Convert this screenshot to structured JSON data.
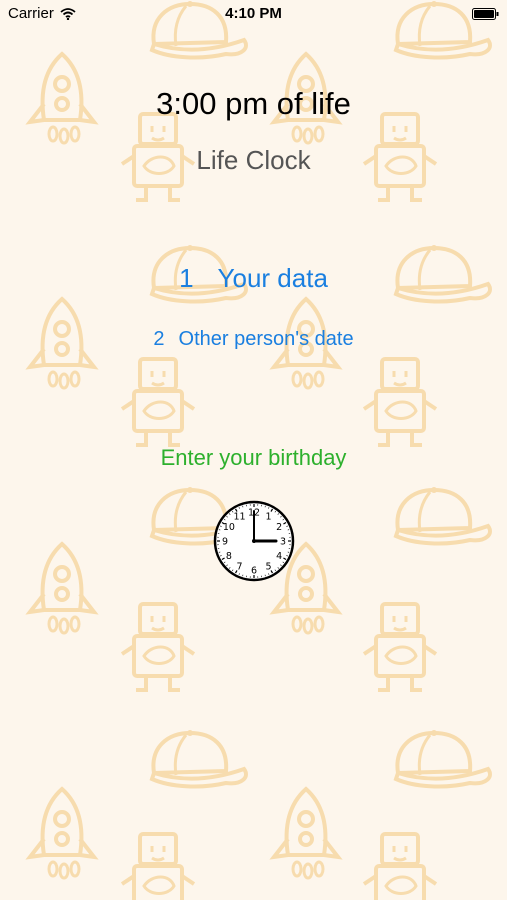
{
  "status_bar": {
    "carrier": "Carrier",
    "time": "4:10 PM",
    "icons": [
      "wifi-icon",
      "battery-icon"
    ]
  },
  "main": {
    "headline": "3:00 pm of life",
    "subtitle": "Life Clock",
    "menu": [
      {
        "number": "1",
        "label": "Your data"
      },
      {
        "number": "2",
        "label": "Other person's date"
      }
    ],
    "prompt": "Enter your birthday",
    "clock": {
      "icon": "clock-icon",
      "numerals": [
        "12",
        "1",
        "2",
        "3",
        "4",
        "5",
        "6",
        "7",
        "8",
        "9",
        "10",
        "11"
      ],
      "hour": 3,
      "minute": 0
    }
  },
  "background": {
    "pattern": [
      "cap-icon",
      "rocket-icon",
      "robot-icon"
    ],
    "color": "#fdf6ec",
    "motif_color": "#f7dcae"
  },
  "colors": {
    "link": "#1a7fe0",
    "prompt": "#2db02d",
    "subtitle": "#555555",
    "headline": "#000000"
  }
}
